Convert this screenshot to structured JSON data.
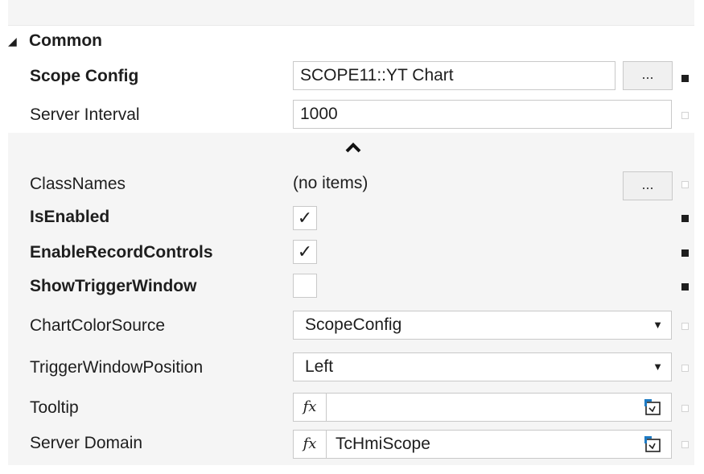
{
  "section": {
    "title": "Common"
  },
  "properties": {
    "scope_config": {
      "label": "Scope Config",
      "value": "SCOPE11::YT Chart",
      "button": "..."
    },
    "server_interval": {
      "label": "Server Interval",
      "value": "1000"
    },
    "class_names": {
      "label": "ClassNames",
      "value": "(no items)",
      "button": "..."
    },
    "is_enabled": {
      "label": "IsEnabled",
      "checked": true,
      "check_glyph": "✓"
    },
    "enable_record_controls": {
      "label": "EnableRecordControls",
      "checked": true,
      "check_glyph": "✓"
    },
    "show_trigger_window": {
      "label": "ShowTriggerWindow",
      "checked": false,
      "check_glyph": ""
    },
    "chart_color_source": {
      "label": "ChartColorSource",
      "value": "ScopeConfig"
    },
    "trigger_window_position": {
      "label": "TriggerWindowPosition",
      "value": "Left"
    },
    "tooltip": {
      "label": "Tooltip",
      "fx": "fx",
      "value": ""
    },
    "server_domain": {
      "label": "Server Domain",
      "fx": "fx",
      "value": "TcHmiScope"
    }
  }
}
